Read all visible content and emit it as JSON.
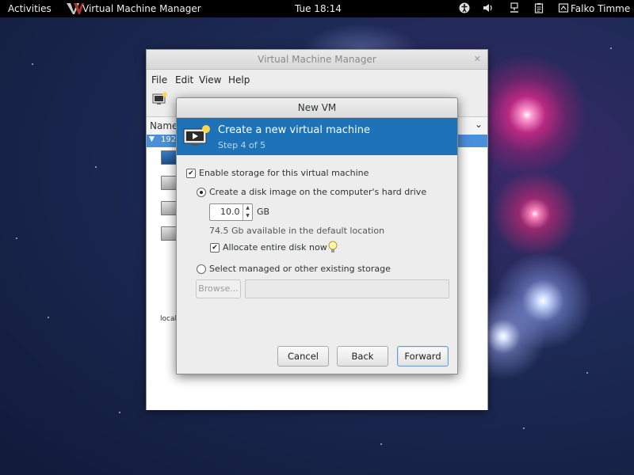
{
  "topbar": {
    "activities": "Activities",
    "app_name": "Virtual Machine Manager",
    "clock": "Tue 18:14",
    "user": "Falko Timme"
  },
  "parent_window": {
    "title": "Virtual Machine Manager",
    "menu": [
      "File",
      "Edit",
      "View",
      "Help"
    ],
    "column_header": "Name",
    "selected_row": "192",
    "local_label": "local"
  },
  "dialog": {
    "title": "New VM",
    "banner_title": "Create a new virtual machine",
    "banner_step": "Step 4 of 5",
    "enable_storage_label": "Enable storage for this virtual machine",
    "enable_storage_checked": true,
    "create_disk_label": "Create a disk image on the computer's hard drive",
    "create_disk_selected": true,
    "disk_size": "10.0",
    "disk_unit": "GB",
    "available_text": "74.5 Gb available in the default location",
    "allocate_label": "Allocate entire disk now",
    "allocate_checked": true,
    "managed_storage_label": "Select managed or other existing storage",
    "managed_storage_selected": false,
    "browse_label": "Browse...",
    "path_value": "",
    "buttons": {
      "cancel": "Cancel",
      "back": "Back",
      "forward": "Forward"
    }
  },
  "colors": {
    "banner": "#1d72b8",
    "selection": "#4a90d9",
    "topbar": "#000000"
  }
}
